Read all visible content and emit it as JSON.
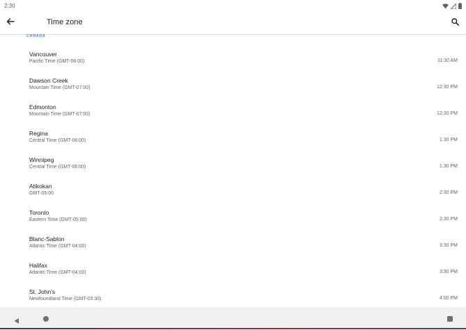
{
  "status_bar": {
    "time": "2:30",
    "icons": [
      "wifi-icon",
      "signal-icon",
      "battery-icon"
    ]
  },
  "app_bar": {
    "title": "Time zone",
    "back_icon": "arrow-back-icon",
    "search_icon": "search-icon"
  },
  "section": {
    "header": "CANADA"
  },
  "timezones": [
    {
      "city": "Vancouver",
      "zone": "Pacific Time (GMT-08:00)",
      "time": "11:30 AM"
    },
    {
      "city": "Dawson Creek",
      "zone": "Mountain Time (GMT-07:00)",
      "time": "12:30 PM"
    },
    {
      "city": "Edmonton",
      "zone": "Mountain Time (GMT-07:00)",
      "time": "12:30 PM"
    },
    {
      "city": "Regina",
      "zone": "Central Time (GMT-06:00)",
      "time": "1:30 PM"
    },
    {
      "city": "Winnipeg",
      "zone": "Central Time (GMT-06:00)",
      "time": "1:30 PM"
    },
    {
      "city": "Atikokan",
      "zone": "GMT-05:00",
      "time": "2:30 PM"
    },
    {
      "city": "Toronto",
      "zone": "Eastern Time (GMT-05:00)",
      "time": "2:30 PM"
    },
    {
      "city": "Blanc-Sablon",
      "zone": "Atlantic Time (GMT-04:00)",
      "time": "3:30 PM"
    },
    {
      "city": "Halifax",
      "zone": "Atlantic Time (GMT-04:00)",
      "time": "3:30 PM"
    },
    {
      "city": "St. John’s",
      "zone": "Newfoundland Time (GMT-03:30)",
      "time": "4:00 PM"
    }
  ],
  "nav_bar": {
    "icons": [
      "nav-back-icon",
      "nav-home-icon",
      "nav-recents-icon"
    ]
  },
  "colors": {
    "accent": "#4a7fd0",
    "primary_text": "#202124",
    "secondary_text": "#5f6368",
    "nav_bar_bg": "#f1f1f1"
  }
}
